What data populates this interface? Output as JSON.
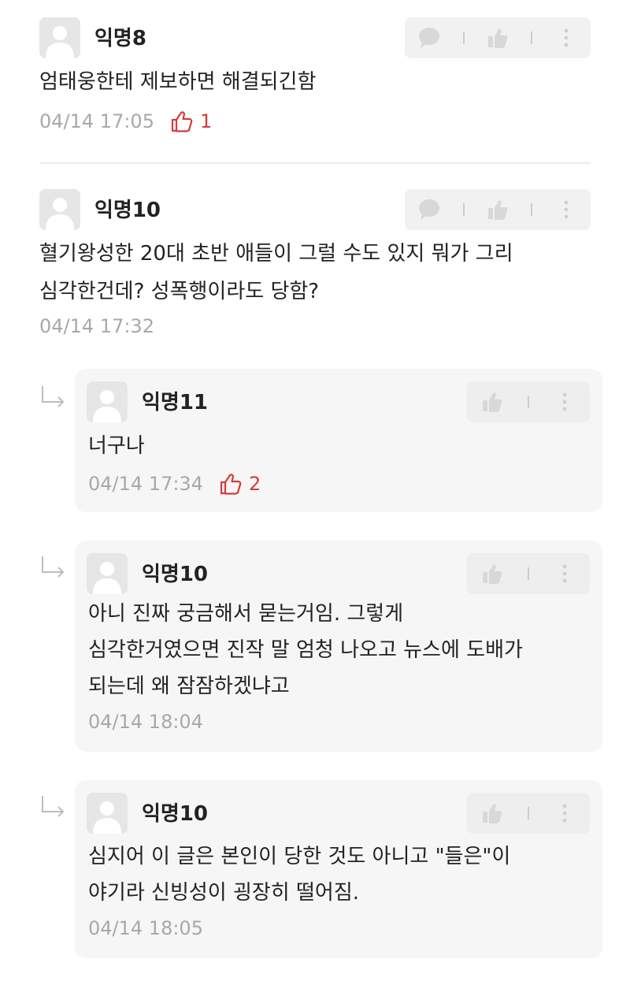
{
  "comments": [
    {
      "nickname": "익명8",
      "lines": [
        "엄태웅한테 제보하면 해결되긴함"
      ],
      "timestamp": "04/14 17:05",
      "likes": "1"
    },
    {
      "nickname": "익명10",
      "lines": [
        "혈기왕성한 20대 초반 애들이 그럴 수도 있지 뭐가 그리",
        "심각한건데? 성폭행이라도 당함?"
      ],
      "timestamp": "04/14 17:32"
    }
  ],
  "replies": [
    {
      "nickname": "익명11",
      "lines": [
        "너구나"
      ],
      "timestamp": "04/14 17:34",
      "likes": "2"
    },
    {
      "nickname": "익명10",
      "lines": [
        "아니 진짜 궁금해서 묻는거임. 그렇게",
        "심각한거였으면 진작 말 엄청 나오고 뉴스에 도배가",
        "되는데 왜 잠잠하겠냐고"
      ],
      "timestamp": "04/14 18:04"
    },
    {
      "nickname": "익명10",
      "lines": [
        "심지어 이 글은 본인이 당한 것도 아니고 \"들은\"이",
        "야기라 신빙성이 굉장히 떨어짐."
      ],
      "timestamp": "04/14 18:05"
    }
  ],
  "icons": {
    "avatar": "default-avatar-icon",
    "comment": "speech-bubble-icon",
    "like": "thumbs-up-icon",
    "more": "vertical-dots-icon",
    "reply": "reply-arrow-icon"
  },
  "colors": {
    "like_accent": "#d63a3a",
    "meta_gray": "#a8a8a8",
    "reply_background": "#f6f6f6",
    "toolbar_background": "#f1f1f1"
  }
}
